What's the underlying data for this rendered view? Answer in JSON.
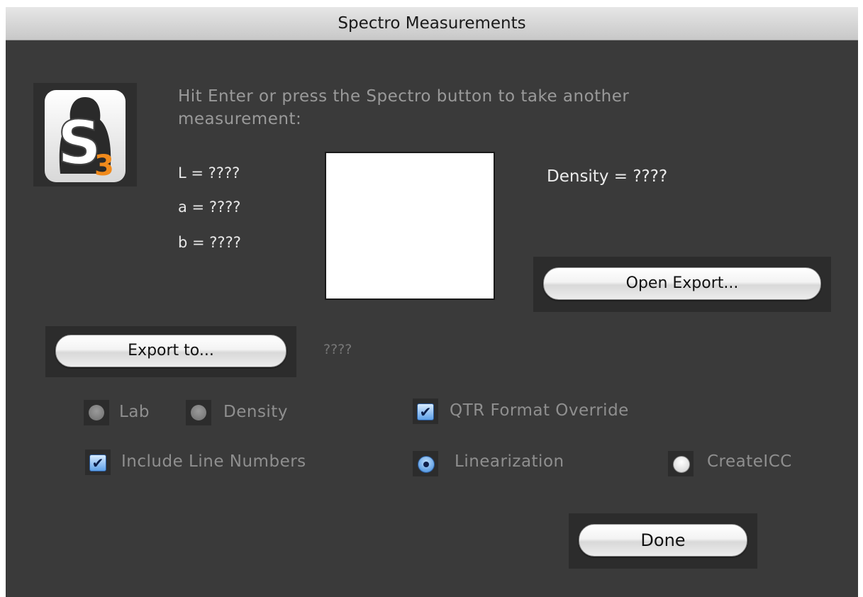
{
  "window": {
    "title": "Spectro Measurements"
  },
  "app_icon": {
    "glyph": "S",
    "sub": "3"
  },
  "instructions": "Hit Enter or press the Spectro button to take another measurement:",
  "lab": {
    "l": "L = ????",
    "a": "a = ????",
    "b": "b = ????"
  },
  "density": "Density = ????",
  "buttons": {
    "open_export": "Open Export...",
    "export_to": "Export to...",
    "done": "Done"
  },
  "export_path": "????",
  "options": {
    "lab_label": "Lab",
    "density_label": "Density",
    "qtr_label": "QTR Format Override",
    "qtr_checked": true,
    "line_numbers_label": "Include Line Numbers",
    "line_numbers_checked": true,
    "linearization_label": "Linearization",
    "linearization_selected": true,
    "createicc_label": "CreateICC",
    "createicc_selected": false
  },
  "colors": {
    "window_bg": "#3a3a3a",
    "accent_orange": "#f08a1c",
    "checkbox_blue": "#5ea0e8"
  }
}
